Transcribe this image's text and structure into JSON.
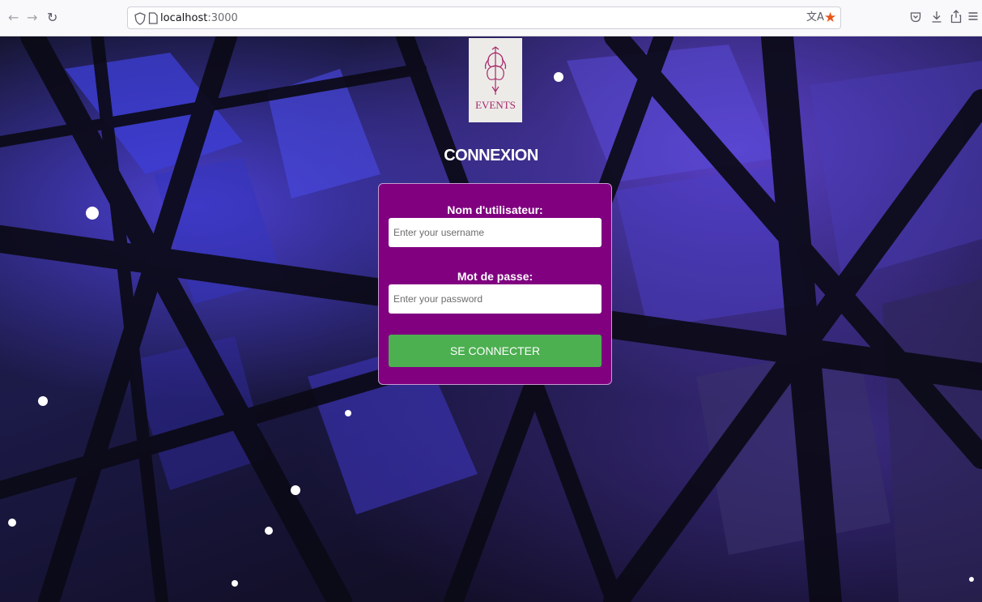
{
  "browser": {
    "url_host": "localhost",
    "url_port": ":3000",
    "icons": [
      "back-icon",
      "forward-icon",
      "reload-icon",
      "shield-icon",
      "page-icon",
      "translate-icon",
      "bookmark-star-icon",
      "pocket-icon",
      "download-icon",
      "share-icon",
      "menu-icon"
    ]
  },
  "logo": {
    "text": "EVENTS"
  },
  "page": {
    "title": "CONNEXION"
  },
  "form": {
    "username_label": "Nom d'utilisateur:",
    "username_placeholder": "Enter your username",
    "password_label": "Mot de passe:",
    "password_placeholder": "Enter your password",
    "submit_label": "SE CONNECTER"
  },
  "colors": {
    "card": "#800080",
    "button": "#4caf50",
    "logo_accent": "#a8276a",
    "bookmark_star": "#e8561c"
  }
}
